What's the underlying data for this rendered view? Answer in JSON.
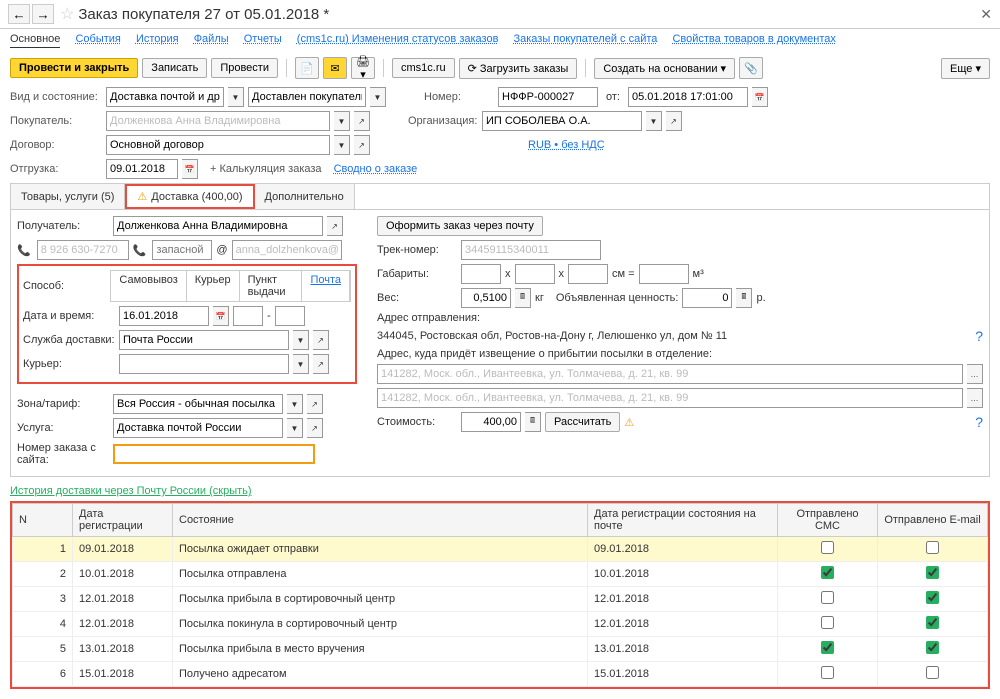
{
  "header": {
    "title": "Заказ покупателя 27 от 05.01.2018 *"
  },
  "nav_tabs": {
    "main": "Основное",
    "events": "События",
    "history": "История",
    "files": "Файлы",
    "reports": "Отчеты",
    "cms_status": "(cms1c.ru) Изменения статусов заказов",
    "site_orders": "Заказы покупателей с сайта",
    "props": "Свойства товаров в документах"
  },
  "toolbar": {
    "post_close": "Провести и закрыть",
    "save": "Записать",
    "post": "Провести",
    "cms": "cms1c.ru",
    "load": "Загрузить заказы",
    "create_based": "Создать на основании",
    "more": "Еще"
  },
  "form": {
    "type_state_lbl": "Вид и состояние:",
    "type_state_1": "Доставка почтой и другое",
    "type_state_2": "Доставлен покупателю",
    "number_lbl": "Номер:",
    "number": "НФФР-000027",
    "from_lbl": "от:",
    "date": "05.01.2018 17:01:00",
    "buyer_lbl": "Покупатель:",
    "buyer": "Долженкова Анна Владимировна",
    "org_lbl": "Организация:",
    "org": "ИП СОБОЛЕВА О.А.",
    "contract_lbl": "Договор:",
    "contract": "Основной договор",
    "currency": "RUB • без НДС",
    "shipment_lbl": "Отгрузка:",
    "shipment_date": "09.01.2018",
    "calc": "+ Калькуляция заказа",
    "summary": "Сводно о заказе"
  },
  "sub_tabs": {
    "goods": "Товары, услуги (5)",
    "delivery": "Доставка (400,00)",
    "extra": "Дополнительно"
  },
  "delivery": {
    "recipient_lbl": "Получатель:",
    "recipient": "Долженкова Анна Владимировна",
    "mail_order_btn": "Оформить заказ через почту",
    "phone1": "8 926 630-7270",
    "phone2_ph": "запасной",
    "email": "anna_dolzhenkova@...",
    "track_lbl": "Трек-номер:",
    "track": "34459115340011",
    "method_lbl": "Способ:",
    "m_self": "Самовывоз",
    "m_courier": "Курьер",
    "m_pickup": "Пункт выдачи",
    "m_post": "Почта",
    "dims_lbl": "Габариты:",
    "dims_x": "x",
    "dims_cm": "см =",
    "dims_m3": "м³",
    "datetime_lbl": "Дата и время:",
    "datetime": "16.01.2018",
    "weight_lbl": "Вес:",
    "weight": "0,5100",
    "weight_unit": "кг",
    "declared_lbl": "Объявленная ценность:",
    "declared": "0",
    "rub": "р.",
    "service_lbl": "Служба доставки:",
    "service": "Почта России",
    "addr_from_lbl": "Адрес отправления:",
    "addr_from": "344045, Ростовская обл, Ростов-на-Дону г, Лелюшенко ул, дом № 11",
    "courier_lbl": "Курьер:",
    "addr_notice_lbl": "Адрес, куда придёт извещение о прибытии посылки в отделение:",
    "addr_notice": "141282, Моск. обл., Ивантеевка, ул. Толмачева, д. 21, кв. 99",
    "zone_lbl": "Зона/тариф:",
    "zone": "Вся Россия - обычная посылка",
    "addr2": "141282, Моск. обл., Ивантеевка, ул. Толмачева, д. 21, кв. 99",
    "serv_lbl": "Услуга:",
    "serv": "Доставка почтой России",
    "cost_lbl": "Стоимость:",
    "cost": "400,00",
    "calc_btn": "Рассчитать",
    "site_order_lbl": "Номер заказа с сайта:"
  },
  "history_link": "История доставки через Почту России (скрыть)",
  "table": {
    "headers": {
      "n": "N",
      "date": "Дата регистрации",
      "state": "Состояние",
      "post_date": "Дата регистрации состояния на почте",
      "sms": "Отправлено СМС",
      "email": "Отправлено E-mail"
    },
    "rows": [
      {
        "n": "1",
        "date": "09.01.2018",
        "state": "Посылка ожидает отправки",
        "post_date": "09.01.2018",
        "sms": false,
        "email": false,
        "hl": true
      },
      {
        "n": "2",
        "date": "10.01.2018",
        "state": "Посылка отправлена",
        "post_date": "10.01.2018",
        "sms": true,
        "email": true
      },
      {
        "n": "3",
        "date": "12.01.2018",
        "state": "Посылка прибыла в сортировочный центр",
        "post_date": "12.01.2018",
        "sms": false,
        "email": true
      },
      {
        "n": "4",
        "date": "12.01.2018",
        "state": "Посылка покинула в сортировочный центр",
        "post_date": "12.01.2018",
        "sms": false,
        "email": true
      },
      {
        "n": "5",
        "date": "13.01.2018",
        "state": "Посылка прибыла в место вручения",
        "post_date": "13.01.2018",
        "sms": true,
        "email": true
      },
      {
        "n": "6",
        "date": "15.01.2018",
        "state": "Получено адресатом",
        "post_date": "15.01.2018",
        "sms": false,
        "email": false
      }
    ]
  }
}
